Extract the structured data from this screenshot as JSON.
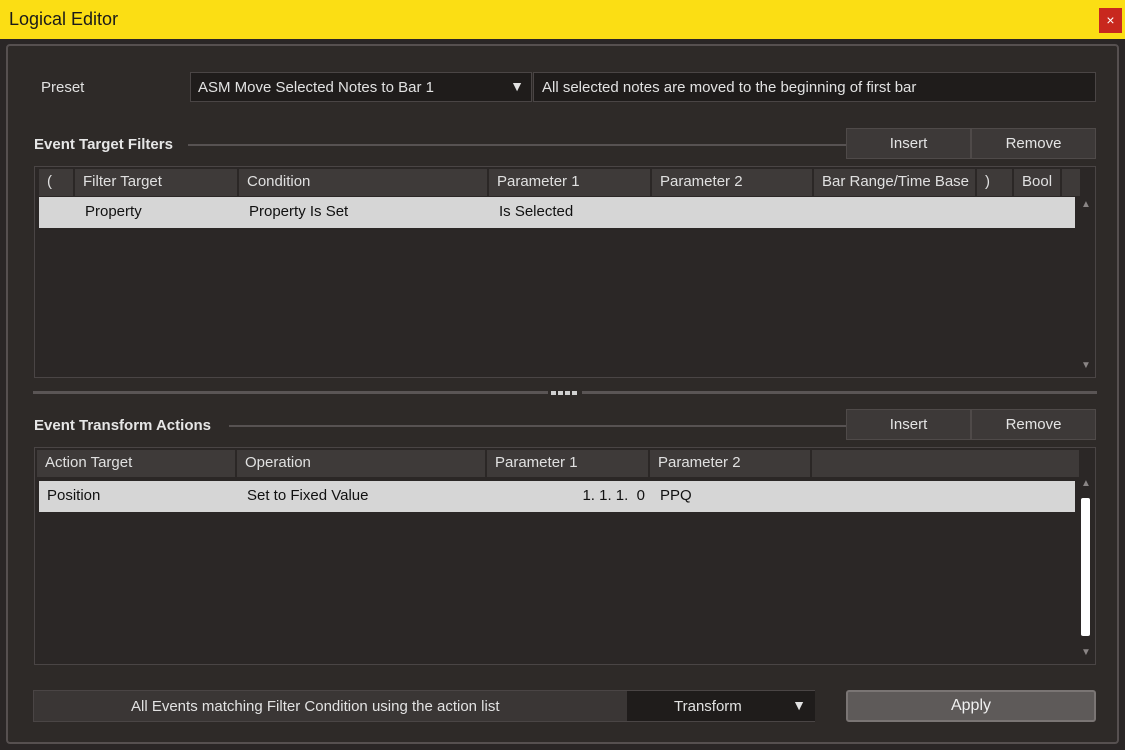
{
  "window": {
    "title": "Logical Editor",
    "close_glyph": "×"
  },
  "preset": {
    "label": "Preset",
    "selected": "ASM Move Selected Notes to Bar 1",
    "arrow": "▼",
    "description": "All selected notes are moved to the beginning of first bar"
  },
  "filters": {
    "title": "Event Target Filters",
    "insert_label": "Insert",
    "remove_label": "Remove",
    "columns": [
      "(",
      "Filter Target",
      "Condition",
      "Parameter 1",
      "Parameter 2",
      "Bar Range/Time Base",
      ")",
      "Bool"
    ],
    "rows": [
      {
        "open": "",
        "target": "Property",
        "condition": "Property Is Set",
        "param1": "Is Selected",
        "param2": "",
        "range": "",
        "close": "",
        "bool": ""
      }
    ]
  },
  "actions": {
    "title": "Event Transform Actions",
    "insert_label": "Insert",
    "remove_label": "Remove",
    "columns": [
      "Action Target",
      "Operation",
      "Parameter 1",
      "Parameter 2"
    ],
    "rows": [
      {
        "target": "Position",
        "operation": "Set to Fixed Value",
        "param1": "1. 1. 1.  0",
        "param2": "PPQ"
      }
    ]
  },
  "footer": {
    "description": "All Events matching Filter Condition using the action list",
    "mode": "Transform",
    "mode_arrow": "▼",
    "apply_label": "Apply"
  },
  "icons": {
    "close": "close-icon",
    "dropdown": "chevron-down-icon",
    "scroll_up": "scroll-up-icon",
    "scroll_down": "scroll-down-icon"
  },
  "colors": {
    "titlebar": "#fbde14",
    "close": "#c8281e",
    "selected_row": "#d6d6d6",
    "background": "#2a2626"
  }
}
